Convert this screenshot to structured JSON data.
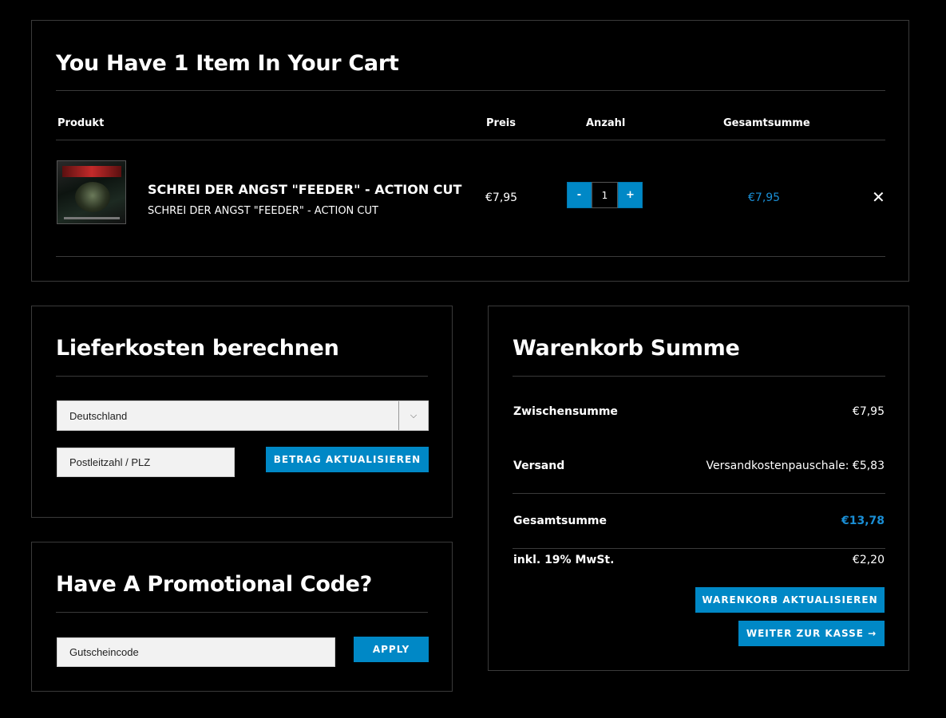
{
  "colors": {
    "accent": "#0088c6",
    "accent_text": "#1a8fd6",
    "background": "#000000",
    "border": "#3a3a3a"
  },
  "cart": {
    "title": "You Have 1 Item In Your Cart",
    "columns": {
      "product": "Produkt",
      "price": "Preis",
      "quantity": "Anzahl",
      "total": "Gesamtsumme"
    },
    "item": {
      "name": "SCHREI DER ANGST \"FEEDER\" - ACTION CUT",
      "subtitle": "SCHREI DER ANGST \"FEEDER\" - ACTION CUT",
      "price": "€7,95",
      "quantity": "1",
      "minus": "-",
      "plus": "+",
      "total": "€7,95",
      "remove": "✕"
    }
  },
  "shipping": {
    "title": "Lieferkosten berechnen",
    "country": "Deutschland",
    "country_arrow": "⌵",
    "postcode_placeholder": "Postleitzahl / PLZ",
    "update_button": "BETRAG AKTUALISIEREN"
  },
  "promo": {
    "title": "Have A Promotional Code?",
    "code_placeholder": "Gutscheincode",
    "apply_button": "APPLY"
  },
  "totals": {
    "title": "Warenkorb Summe",
    "subtotal_label": "Zwischensumme",
    "subtotal_value": "€7,95",
    "shipping_label": "Versand",
    "shipping_value": "Versandkostenpauschale: €5,83",
    "total_label": "Gesamtsumme",
    "total_value": "€13,78",
    "tax_label": "inkl. 19% MwSt.",
    "tax_value": "€2,20",
    "update_cart_button": "WARENKORB AKTUALISIEREN",
    "checkout_button": "WEITER ZUR KASSE →"
  }
}
